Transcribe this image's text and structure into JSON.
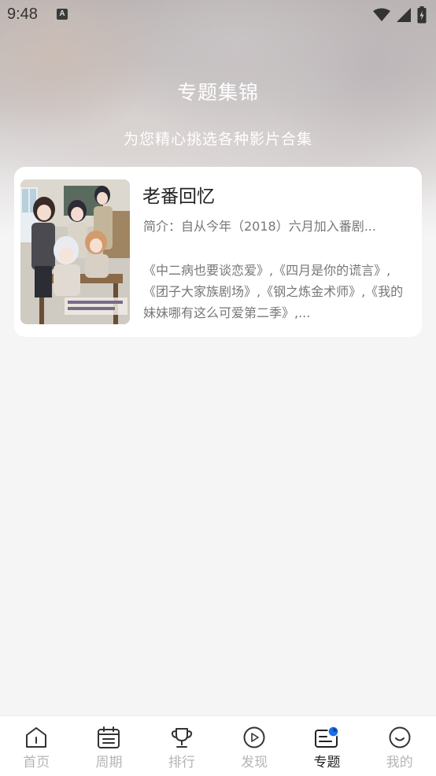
{
  "status_bar": {
    "time": "9:48",
    "notification_badge": "A"
  },
  "header": {
    "title": "专题集锦",
    "subtitle": "为您精心挑选各种影片合集"
  },
  "collections": [
    {
      "title": "老番回忆",
      "intro": "简介：自从今年（2018）六月加入番剧...",
      "list": "《中二病也要谈恋爱》,《四月是你的谎言》,《团子大家族剧场》,《钢之炼金术师》,《我的妹妹哪有这么可爱第二季》,..."
    }
  ],
  "nav": {
    "items": [
      {
        "label": "首页",
        "icon": "home-icon"
      },
      {
        "label": "周期",
        "icon": "calendar-icon"
      },
      {
        "label": "排行",
        "icon": "trophy-icon"
      },
      {
        "label": "发现",
        "icon": "play-circle-icon"
      },
      {
        "label": "专题",
        "icon": "topic-card-icon",
        "active": true
      },
      {
        "label": "我的",
        "icon": "smile-face-icon"
      }
    ],
    "accent_color": "#1a6ee8",
    "active_color": "#222222",
    "inactive_color": "#b5b5b5"
  }
}
